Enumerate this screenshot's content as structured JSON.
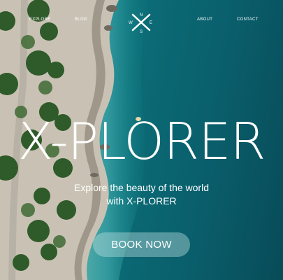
{
  "nav": {
    "explore_label": "EXPLORE",
    "blog_label": "BLOG",
    "about_label": "ABOUT",
    "contact_label": "CONTACT"
  },
  "logo": {
    "n": "N",
    "e": "E",
    "w": "W",
    "s": "S"
  },
  "hero": {
    "title": "X-PLORER",
    "tagline_line1": "Explore the beauty of the world",
    "tagline_line2": "with X-PLORER",
    "cta_label": "BOOK NOW"
  },
  "colors": {
    "sea_dark": "#084b58",
    "sea_mid": "#0b6e78",
    "shallow": "#4fb3b0",
    "sand": "#c9c2b4",
    "vegetation": "#2f5a2a",
    "text": "#ffffff",
    "cta_bg": "rgba(190,225,225,0.42)"
  },
  "icons": [
    "compass-logo-icon"
  ]
}
